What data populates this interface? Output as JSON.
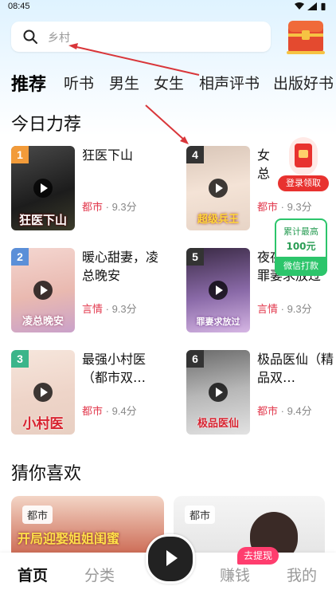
{
  "status_bar": {
    "time": "08:45"
  },
  "search": {
    "placeholder": "乡村"
  },
  "tabs": [
    "推荐",
    "听书",
    "男生",
    "女生",
    "相声评书",
    "出版好书"
  ],
  "sections": {
    "today": "今日力荐",
    "guess": "猜你喜欢"
  },
  "books": [
    {
      "rank": "1",
      "title": "狂医下山",
      "cover_text": "狂医下山",
      "genre": "都市",
      "score": "9.3分"
    },
    {
      "rank": "4",
      "title": "女总裁的超级兵王",
      "cover_text": "超级兵王",
      "genre": "都市",
      "score": "9.3分"
    },
    {
      "rank": "2",
      "title": "暖心甜妻，凌总晚安",
      "cover_text": "凌总晚安",
      "genre": "言情",
      "score": "9.3分"
    },
    {
      "rank": "5",
      "title": "夜夜宠妻：罪妻求放过",
      "cover_text": "罪妻求放过",
      "genre": "言情",
      "score": "9.3分"
    },
    {
      "rank": "3",
      "title": "最强小村医（都市双…",
      "cover_text": "小村医",
      "genre": "都市",
      "score": "9.4分"
    },
    {
      "rank": "6",
      "title": "极品医仙（精品双…",
      "cover_text": "极品医仙",
      "genre": "都市",
      "score": "9.4分"
    }
  ],
  "floats": {
    "login_reward": "登录领取",
    "wechat": {
      "line1": "累计最高",
      "amount": "100元",
      "action": "微信打款"
    }
  },
  "guess_cards": [
    {
      "tag": "都市",
      "cover_text": "开局迎娶姐姐闺蜜"
    },
    {
      "tag": "都市"
    }
  ],
  "bottom_nav": {
    "home": "首页",
    "category": "分类",
    "earn": "赚钱",
    "mine": "我的",
    "withdraw": "去提现"
  },
  "colors": {
    "accent_red": "#e23a4e",
    "accent_green": "#2cc56b"
  }
}
